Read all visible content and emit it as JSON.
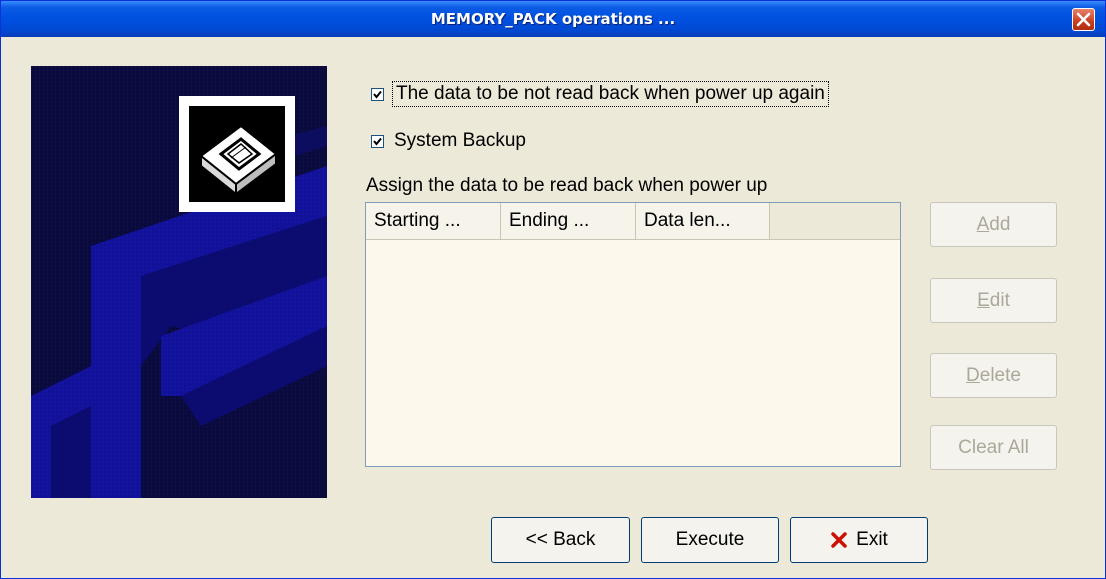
{
  "window": {
    "title": "MEMORY_PACK operations ..."
  },
  "options": {
    "no_readback": {
      "label": "The data to be not read back when power up again",
      "checked": true
    },
    "system_backup": {
      "label": "System Backup",
      "checked": true
    }
  },
  "readback": {
    "label": "Assign the data to be read back when power up",
    "columns": [
      "Starting ...",
      "Ending ...",
      "Data len..."
    ],
    "rows": []
  },
  "side_buttons": {
    "add": {
      "label": "Add",
      "mnemonic": "A",
      "rest": "dd",
      "enabled": false
    },
    "edit": {
      "label": "Edit",
      "mnemonic": "E",
      "rest": "dit",
      "enabled": false
    },
    "delete": {
      "label": "Delete",
      "mnemonic": "D",
      "rest": "elete",
      "enabled": false
    },
    "clear_all": {
      "label": "Clear All",
      "enabled": false
    }
  },
  "footer": {
    "back": "<< Back",
    "execute": "Execute",
    "exit": "Exit"
  },
  "colors": {
    "accent": "#0050E0",
    "side_art_bg": "#0A0A3C",
    "side_art_blue": "#1010A0",
    "exit_icon": "#CC1100"
  },
  "icons": {
    "window_close": "close-icon",
    "wizard": "memory-pack-icon",
    "exit": "x-mark-icon"
  }
}
